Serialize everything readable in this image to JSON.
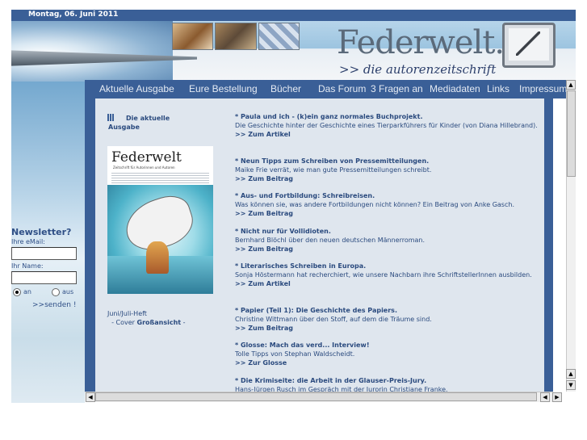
{
  "date": "Montag, 06. Juni 2011",
  "brand": {
    "title": "Federwelt.",
    "tagline": ">> die autorenzeitschrift"
  },
  "nav": [
    {
      "label": "Aktuelle Ausgabe"
    },
    {
      "label": "Eure Bestellung"
    },
    {
      "label": "Bücher"
    },
    {
      "label": "Das Forum"
    },
    {
      "label": "3 Fragen an"
    },
    {
      "label": "Mediadaten"
    },
    {
      "label": "Links"
    },
    {
      "label": "Impressum"
    }
  ],
  "newsletter": {
    "title": "Newsletter?",
    "email_label": "Ihre eMail:",
    "email_value": "",
    "name_label": "Ihr Name:",
    "name_value": "",
    "option_on": "an",
    "option_off": "aus",
    "send": ">>senden !"
  },
  "cover": {
    "heading": "Die aktuelle Ausgabe",
    "logo": "Federwelt",
    "subtitle": "Zeitschrift für Autorinnen und Autoren",
    "issue": "Juni/Juli-Heft",
    "cover_prefix": "- Cover",
    "cover_link": "Großansicht",
    "cover_suffix": "-"
  },
  "articles": [
    {
      "head": "* Paula und ich - (k)ein ganz normales Buchprojekt.",
      "text": "Die Geschichte hinter der Geschichte eines Tierparkführers für Kinder (von Diana Hillebrand).",
      "link": ">> Zum Artikel"
    },
    {
      "head": "* Neun Tipps zum Schreiben von Pressemitteilungen.",
      "text": "Maike Frie verrät, wie man gute Pressemitteilungen schreibt.",
      "link": ">> Zum Beitrag"
    },
    {
      "head": "* Aus- und Fortbildung: Schreibreisen.",
      "text": "Was können sie, was andere Fortbildungen nicht können? Ein Beitrag von Anke Gasch.",
      "link": ">> Zum Beitrag"
    },
    {
      "head": "* Nicht nur für Vollidioten.",
      "text": "Bernhard Blöchl über den neuen deutschen Männerroman.",
      "link": ">> Zum Beitrag"
    },
    {
      "head": "* Literarisches Schreiben in Europa.",
      "text": "Sonja Höstermann hat recherchiert, wie unsere Nachbarn ihre SchriftstellerInnen ausbilden.",
      "link": ">> Zum Artikel"
    },
    {
      "head": "* Papier (Teil 1): Die Geschichte des Papiers.",
      "text": "Christine Wittmann über den Stoff, auf dem die Träume sind.",
      "link": ">> Zum Beitrag"
    },
    {
      "head": "* Glosse: Mach das verd... Interview!",
      "text": "Tolle Tipps von Stephan Waldscheidt.",
      "link": ">> Zur Glosse"
    },
    {
      "head": "* Die Krimiseite: die Arbeit in der Glauser-Preis-Jury.",
      "text": "Hans-Jürgen Rusch im Gespräch mit der Jurorin Christiane Franke.",
      "link": ""
    }
  ],
  "colors": {
    "nav_bg": "#3a5f97",
    "content_bg": "#dfe6ee",
    "link": "#2a4a7e"
  }
}
